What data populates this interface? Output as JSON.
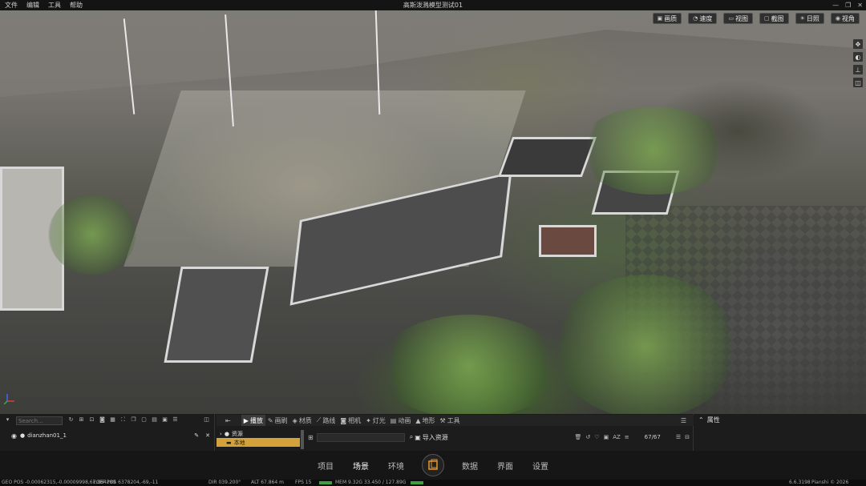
{
  "menu": [
    "文件",
    "编辑",
    "工具",
    "帮助"
  ],
  "window_title": "高斯泼溅模型测试01",
  "window_controls": [
    "—",
    "❐",
    "✕"
  ],
  "viewport_toolbar": [
    {
      "icon": "image-icon",
      "glyph": "▣",
      "label": "画质"
    },
    {
      "icon": "speed-icon",
      "glyph": "◔",
      "label": "速度"
    },
    {
      "icon": "view-icon",
      "glyph": "▭",
      "label": "视图"
    },
    {
      "icon": "screenshot-icon",
      "glyph": "▢",
      "label": "截图"
    },
    {
      "icon": "sun-icon",
      "glyph": "☀",
      "label": "日照"
    },
    {
      "icon": "eye-icon",
      "glyph": "◉",
      "label": "视角"
    }
  ],
  "side_tools": [
    "✥",
    "◐",
    "⊥",
    "◫"
  ],
  "outliner": {
    "search_placeholder": "Search...",
    "item": "dianzhan01_1"
  },
  "content_tabs": [
    {
      "icon": "play-icon",
      "glyph": "▶",
      "label": "播放",
      "active": true
    },
    {
      "icon": "brush-icon",
      "glyph": "✎",
      "label": "画刷"
    },
    {
      "icon": "material-icon",
      "glyph": "◈",
      "label": "材质"
    },
    {
      "icon": "path-icon",
      "glyph": "⟋",
      "label": "路线"
    },
    {
      "icon": "camera-icon",
      "glyph": "◙",
      "label": "相机"
    },
    {
      "icon": "light-icon",
      "glyph": "✦",
      "label": "灯光"
    },
    {
      "icon": "animation-icon",
      "glyph": "▤",
      "label": "动画"
    },
    {
      "icon": "terrain-icon",
      "glyph": "▲",
      "label": "地形"
    },
    {
      "icon": "tool-icon",
      "glyph": "⚒",
      "label": "工具"
    }
  ],
  "asset_tree": [
    {
      "label": "资源",
      "selected": false
    },
    {
      "label": "本地",
      "selected": true
    }
  ],
  "import_label": "导入资源",
  "asset_count": "67/67",
  "properties_title": "属性",
  "nav": [
    {
      "label": "项目",
      "active": false
    },
    {
      "label": "场景",
      "active": true
    },
    {
      "label": "环境",
      "active": false
    },
    {
      "label": "数据",
      "active": false
    },
    {
      "label": "界面",
      "active": false
    },
    {
      "label": "设置",
      "active": false
    }
  ],
  "status": {
    "geo_pos": "GEO POS  -0.00062315,-0.00009998,67.864289",
    "ecef_pos": "ECEF POS  6378204,-69,-11",
    "dir": "DIR  039.200°",
    "alt": "ALT  67.864 m",
    "fps": "FPS  15",
    "mem": "MEM  9.32G  33.450 / 127.89G",
    "version": "6.6.3198",
    "copyright": "Pianshi © 2026"
  },
  "colors": {
    "accent": "#d4a23a",
    "bg": "#1c1c1c"
  }
}
